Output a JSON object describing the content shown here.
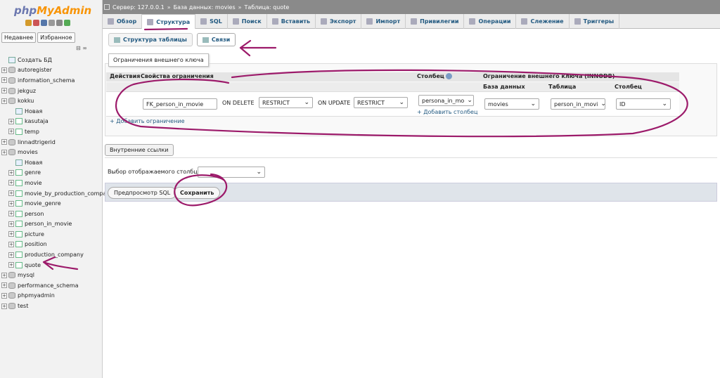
{
  "sidebar": {
    "logo_a": "php",
    "logo_b": "MyAdmin",
    "tabs": [
      "Недавнее",
      "Избранное"
    ],
    "collapse": "⊟ ∞",
    "items": [
      {
        "label": "Создать БД",
        "level": 0,
        "icon": "new"
      },
      {
        "label": "autoregister",
        "level": 0,
        "icon": "db"
      },
      {
        "label": "information_schema",
        "level": 0,
        "icon": "db"
      },
      {
        "label": "jekguz",
        "level": 0,
        "icon": "db"
      },
      {
        "label": "kokku",
        "level": 0,
        "icon": "db"
      },
      {
        "label": "Новая",
        "level": 1,
        "icon": "new"
      },
      {
        "label": "kasutaja",
        "level": 1,
        "icon": "tbl"
      },
      {
        "label": "temp",
        "level": 1,
        "icon": "tbl"
      },
      {
        "label": "linnadtrigerid",
        "level": 0,
        "icon": "db"
      },
      {
        "label": "movies",
        "level": 0,
        "icon": "db"
      },
      {
        "label": "Новая",
        "level": 1,
        "icon": "new"
      },
      {
        "label": "genre",
        "level": 1,
        "icon": "tbl"
      },
      {
        "label": "movie",
        "level": 1,
        "icon": "tbl"
      },
      {
        "label": "movie_by_production_company",
        "level": 1,
        "icon": "tbl"
      },
      {
        "label": "movie_genre",
        "level": 1,
        "icon": "tbl"
      },
      {
        "label": "person",
        "level": 1,
        "icon": "tbl"
      },
      {
        "label": "person_in_movie",
        "level": 1,
        "icon": "tbl"
      },
      {
        "label": "picture",
        "level": 1,
        "icon": "tbl"
      },
      {
        "label": "position",
        "level": 1,
        "icon": "tbl"
      },
      {
        "label": "production_company",
        "level": 1,
        "icon": "tbl"
      },
      {
        "label": "quote",
        "level": 1,
        "icon": "tbl"
      },
      {
        "label": "mysql",
        "level": 0,
        "icon": "db"
      },
      {
        "label": "performance_schema",
        "level": 0,
        "icon": "db"
      },
      {
        "label": "phpmyadmin",
        "level": 0,
        "icon": "db"
      },
      {
        "label": "test",
        "level": 0,
        "icon": "db"
      }
    ]
  },
  "breadcrumb": {
    "server": "Сервер: 127.0.0.1",
    "database": "База данных: movies",
    "table": "Таблица: quote",
    "sep": "»"
  },
  "tabs": [
    "Обзор",
    "Структура",
    "SQL",
    "Поиск",
    "Вставить",
    "Экспорт",
    "Импорт",
    "Привилегии",
    "Операции",
    "Слежение",
    "Триггеры"
  ],
  "subtabs": [
    "Структура таблицы",
    "Связи"
  ],
  "fk": {
    "legend": "Ограничения внешнего ключа",
    "h_actions": "Действия",
    "h_props": "Свойства ограничения",
    "h_column": "Столбец",
    "h_fk": "Ограничение внешнего ключа (INNODB)",
    "h_db": "База данных",
    "h_table": "Таблица",
    "h_col": "Столбец",
    "constraint_name": "FK_person_in_movie",
    "on_delete_label": "ON DELETE",
    "on_delete": "RESTRICT",
    "on_update_label": "ON UPDATE",
    "on_update": "RESTRICT",
    "column": "persona_in_mo",
    "add_column": "+ Добавить столбец",
    "db": "movies",
    "table": "person_in_movi",
    "ref_col": "ID",
    "add_constraint": "+ Добавить ограничение"
  },
  "internal_links": "Внутренние ссылки",
  "display_column_label": "Выбор отображаемого столбца",
  "preview_sql": "Предпросмотр SQL",
  "save": "Сохранить",
  "colors": {
    "accent": "#235a81",
    "annotation": "#9c1a6a"
  }
}
